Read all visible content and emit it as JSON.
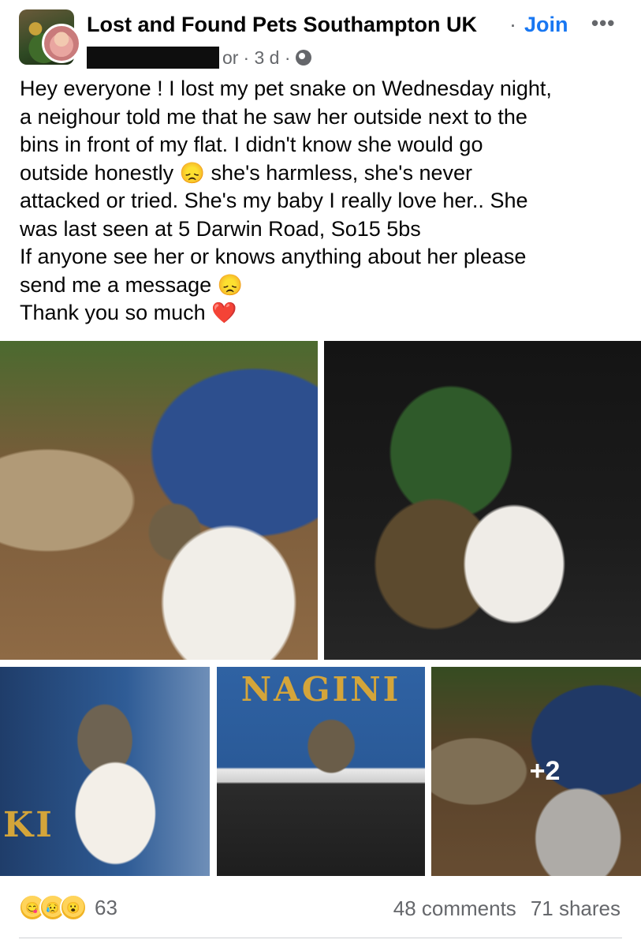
{
  "header": {
    "group_name": "Lost and Found Pets Southampton UK",
    "separator": "·",
    "join_label": "Join",
    "more_icon": "more-icon",
    "author_visible_fragment": "or",
    "timestamp": "· 3 d ·",
    "privacy_icon": "globe-icon"
  },
  "post": {
    "lines": [
      "Hey everyone ! I lost my pet snake on Wednesday night,",
      "a neighour told me that he saw her outside next to the",
      "bins in front of my flat. I didn't know she would go",
      "outside honestly",
      "she's harmless, she's never",
      "attacked or tried. She's my baby I really love her.. She",
      "was last seen at 5 Darwin Road, So15 5bs",
      "If anyone see her or knows anything about her please",
      "send me a message",
      "Thank you so much"
    ],
    "emoji_sad": "😞",
    "emoji_heart": "❤️"
  },
  "photos": {
    "label_nagini": "NAGINI",
    "label_ki": "KI",
    "more_count": "+2"
  },
  "footer": {
    "reaction_icons": [
      "😋",
      "😥",
      "😮"
    ],
    "reaction_count": "63",
    "comments": "48 comments",
    "shares": "71 shares"
  },
  "colors": {
    "link": "#1877f2",
    "secondary_text": "#65676b",
    "text": "#050505"
  }
}
